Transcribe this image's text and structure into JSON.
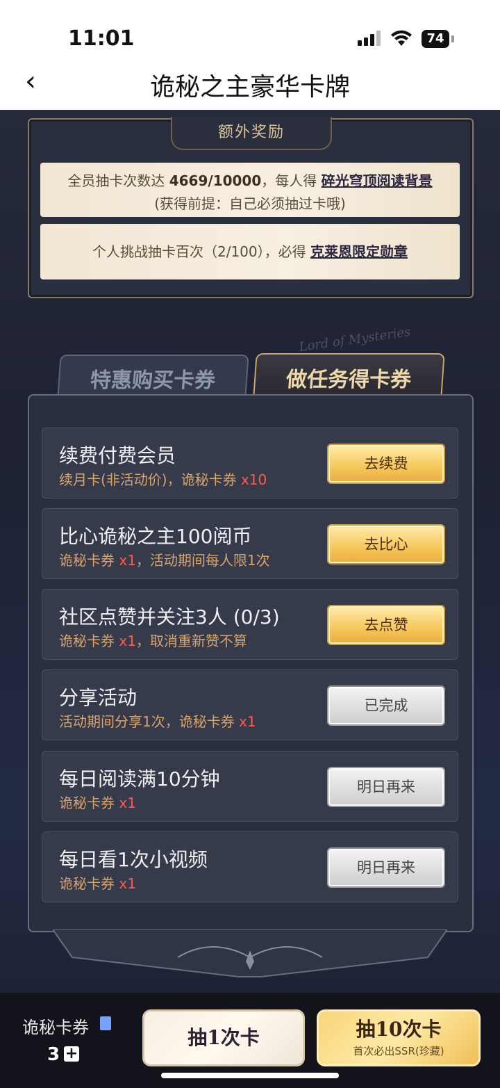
{
  "status": {
    "time": "11:01",
    "battery": "74"
  },
  "nav": {
    "title": "诡秘之主豪华卡牌"
  },
  "bonus": {
    "title": "额外奖励",
    "line1_prefix": "全员抽卡次数达 ",
    "line1_count": "4669/10000",
    "line1_mid": "，每人得 ",
    "line1_link": "碎光穹顶阅读背景",
    "line2": "(获得前提：自己必须抽过卡哦)",
    "line3_prefix": "个人挑战抽卡百次（2/100），必得 ",
    "line3_link": "克莱恩限定勋章"
  },
  "decor": {
    "text": "Lord of Mysteries"
  },
  "tabs": {
    "inactive": "特惠购买卡券",
    "active": "做任务得卡券"
  },
  "tasks": [
    {
      "title": "续费付费会员",
      "sub_prefix": "续月卡(非活动价)，诡秘卡券 ",
      "sub_red": "x10",
      "sub_suffix": "",
      "button": "去续费",
      "style": "gold"
    },
    {
      "title": "比心诡秘之主100阅币",
      "sub_prefix": "诡秘卡券 ",
      "sub_red": "x1",
      "sub_suffix": "，活动期间每人限1次",
      "button": "去比心",
      "style": "gold"
    },
    {
      "title": "社区点赞并关注3人 (0/3)",
      "sub_prefix": "诡秘卡券 ",
      "sub_red": "x1",
      "sub_suffix": "，取消重新赞不算",
      "button": "去点赞",
      "style": "gold"
    },
    {
      "title": "分享活动",
      "sub_prefix": "活动期间分享1次，诡秘卡券 ",
      "sub_red": "x1",
      "sub_suffix": "",
      "button": "已完成",
      "style": "gray"
    },
    {
      "title": "每日阅读满10分钟",
      "sub_prefix": "诡秘卡券 ",
      "sub_red": "x1",
      "sub_suffix": "",
      "button": "明日再来",
      "style": "gray"
    },
    {
      "title": "每日看1次小视频",
      "sub_prefix": "诡秘卡券 ",
      "sub_red": "x1",
      "sub_suffix": "",
      "button": "明日再来",
      "style": "gray"
    }
  ],
  "bottom": {
    "ticket_label": "诡秘卡券",
    "ticket_count": "3",
    "draw1": "抽1次卡",
    "draw10": "抽10次卡",
    "draw10_sub": "首次必出SSR(珍藏)"
  }
}
